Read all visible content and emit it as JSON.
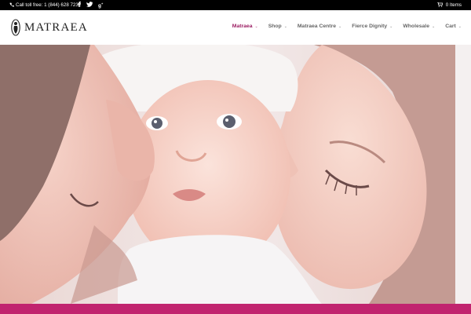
{
  "topbar": {
    "phone_text": "Call toll free: 1 (844) 628 7232",
    "social_icons": [
      "facebook-icon",
      "twitter-icon",
      "google-plus-icon"
    ],
    "cart_text": "0 Items"
  },
  "header": {
    "logo_text": "MATRAEA",
    "nav": [
      {
        "label": "Matraea",
        "active": true
      },
      {
        "label": "Shop",
        "active": false
      },
      {
        "label": "Matraea Centre",
        "active": false
      },
      {
        "label": "Fierce Dignity",
        "active": false
      },
      {
        "label": "Wholesale",
        "active": false
      },
      {
        "label": "Cart",
        "active": false
      }
    ]
  },
  "colors": {
    "accent": "#9c1e63",
    "bottom_bar": "#c1246f",
    "topbar_bg": "#000000"
  },
  "hero": {
    "image_subject": "parents-kissing-baby-photo"
  }
}
